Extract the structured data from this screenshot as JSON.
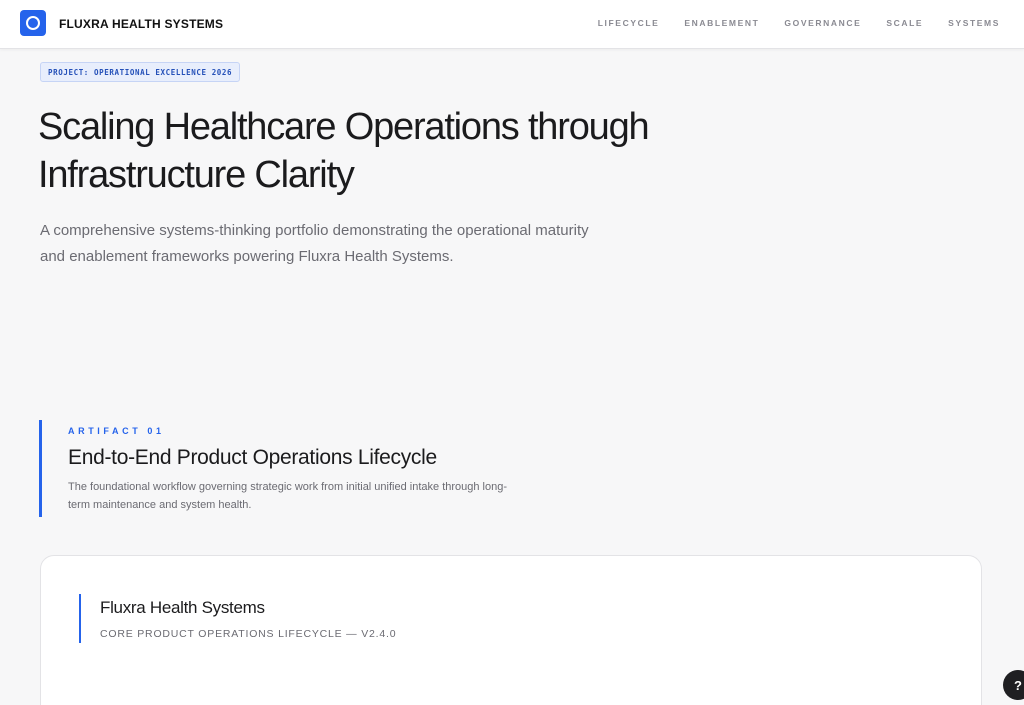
{
  "header": {
    "brand": "FLUXRA HEALTH SYSTEMS",
    "nav": [
      "LIFECYCLE",
      "ENABLEMENT",
      "GOVERNANCE",
      "SCALE",
      "SYSTEMS"
    ]
  },
  "hero": {
    "project_tag": "PROJECT: OPERATIONAL EXCELLENCE 2026",
    "title": "Scaling Healthcare Operations through Infrastructure Clarity",
    "subtitle": "A comprehensive systems-thinking portfolio demonstrating the operational maturity and enablement frameworks powering Fluxra Health Systems."
  },
  "artifact": {
    "kicker": "ARTIFACT 01",
    "title": "End-to-End Product Operations Lifecycle",
    "description": "The foundational workflow governing strategic work from initial unified intake through long-term maintenance and system health."
  },
  "card": {
    "title": "Fluxra Health Systems",
    "subtitle": "CORE PRODUCT OPERATIONS LIFECYCLE — V2.4.0"
  },
  "help": {
    "label": "?"
  },
  "colors": {
    "accent": "#2563eb",
    "background": "#f7f7f8"
  }
}
